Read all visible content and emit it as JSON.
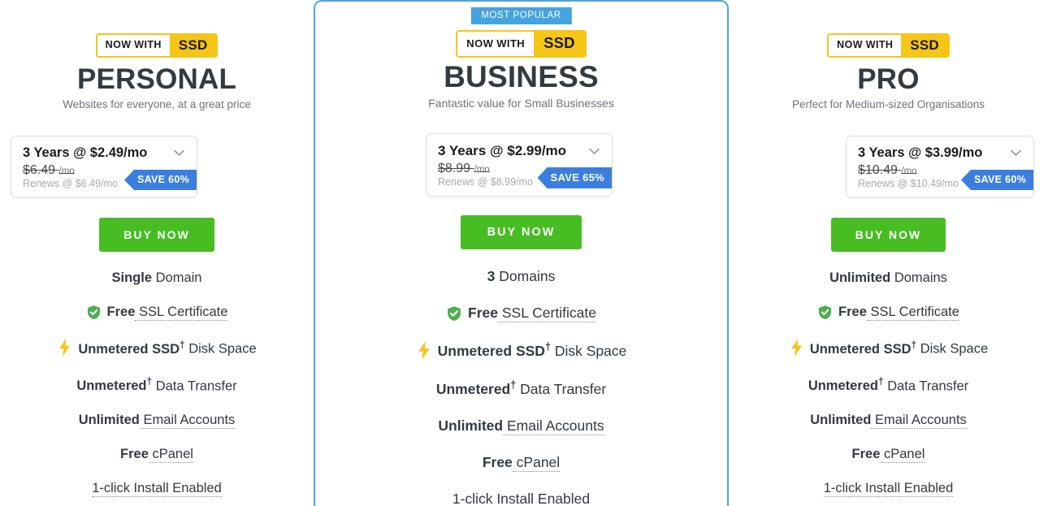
{
  "page": {
    "most_popular_label": "MOST POPULAR",
    "colors": {
      "highlight_border": "#4fa3dd",
      "popular_badge": "#44a3e0",
      "ssd_yellow": "#f5c518",
      "buy_green": "#47bd23",
      "save_blue": "#3a7fe0",
      "shield_green": "#4caf50",
      "bolt_yellow": "#f7c21b",
      "title_gray": "#333a40"
    }
  },
  "plans": [
    {
      "id": "personal",
      "badge": {
        "prefix": "NOW WITH",
        "suffix": "SSD"
      },
      "title": "PERSONAL",
      "subtitle": "Websites for everyone, at a great price",
      "price": {
        "term": "3 Years @ $2.49/mo",
        "old_price": "$6.49",
        "old_unit": "/mo",
        "renews": "Renews @ $6.49/mo",
        "save": "SAVE 60%"
      },
      "buy_label": "BUY NOW",
      "features": [
        {
          "icon": "none",
          "strong": "Single",
          "rest": " Domain",
          "dotted": false,
          "dagger": false
        },
        {
          "icon": "shield-check",
          "strong": "Free",
          "rest": " SSL Certificate",
          "dotted": true,
          "dagger": false
        },
        {
          "icon": "lightning-bolt",
          "strong": "Unmetered SSD",
          "rest": " Disk Space",
          "dotted": false,
          "dagger": true
        },
        {
          "icon": "none",
          "strong": "Unmetered",
          "rest": " Data Transfer",
          "dotted": false,
          "dagger": true
        },
        {
          "icon": "none",
          "strong": "Unlimited",
          "rest": " Email Accounts",
          "dotted": true,
          "dagger": false
        },
        {
          "icon": "none",
          "strong": "Free",
          "rest": " cPanel",
          "dotted": true,
          "dagger": false
        },
        {
          "icon": "none",
          "strong": "",
          "rest": "1-click Install Enabled",
          "dotted": true,
          "dagger": false
        }
      ]
    },
    {
      "id": "business",
      "badge": {
        "prefix": "NOW WITH",
        "suffix": "SSD"
      },
      "title": "BUSINESS",
      "subtitle": "Fantastic value for Small Businesses",
      "price": {
        "term": "3 Years @ $2.99/mo",
        "old_price": "$8.99",
        "old_unit": "/mo",
        "renews": "Renews @ $8.99/mo",
        "save": "SAVE 65%"
      },
      "buy_label": "BUY NOW",
      "features": [
        {
          "icon": "none",
          "strong": "3",
          "rest": " Domains",
          "dotted": false,
          "dagger": false
        },
        {
          "icon": "shield-check",
          "strong": "Free",
          "rest": " SSL Certificate",
          "dotted": true,
          "dagger": false
        },
        {
          "icon": "lightning-bolt",
          "strong": "Unmetered SSD",
          "rest": " Disk Space",
          "dotted": false,
          "dagger": true
        },
        {
          "icon": "none",
          "strong": "Unmetered",
          "rest": " Data Transfer",
          "dotted": false,
          "dagger": true
        },
        {
          "icon": "none",
          "strong": "Unlimited",
          "rest": " Email Accounts",
          "dotted": true,
          "dagger": false
        },
        {
          "icon": "none",
          "strong": "Free",
          "rest": " cPanel",
          "dotted": true,
          "dagger": false
        },
        {
          "icon": "none",
          "strong": "",
          "rest": "1-click Install Enabled",
          "dotted": true,
          "dagger": false
        }
      ]
    },
    {
      "id": "pro",
      "badge": {
        "prefix": "NOW WITH",
        "suffix": "SSD"
      },
      "title": "PRO",
      "subtitle": "Perfect for Medium-sized Organisations",
      "price": {
        "term": "3 Years @ $3.99/mo",
        "old_price": "$10.49",
        "old_unit": "/mo",
        "renews": "Renews @ $10.49/mo",
        "save": "SAVE 60%"
      },
      "buy_label": "BUY NOW",
      "features": [
        {
          "icon": "none",
          "strong": "Unlimited",
          "rest": " Domains",
          "dotted": false,
          "dagger": false
        },
        {
          "icon": "shield-check",
          "strong": "Free",
          "rest": " SSL Certificate",
          "dotted": true,
          "dagger": false
        },
        {
          "icon": "lightning-bolt",
          "strong": "Unmetered SSD",
          "rest": " Disk Space",
          "dotted": false,
          "dagger": true
        },
        {
          "icon": "none",
          "strong": "Unmetered",
          "rest": " Data Transfer",
          "dotted": false,
          "dagger": true
        },
        {
          "icon": "none",
          "strong": "Unlimited",
          "rest": " Email Accounts",
          "dotted": true,
          "dagger": false
        },
        {
          "icon": "none",
          "strong": "Free",
          "rest": " cPanel",
          "dotted": true,
          "dagger": false
        },
        {
          "icon": "none",
          "strong": "",
          "rest": "1-click Install Enabled",
          "dotted": true,
          "dagger": false
        }
      ]
    }
  ]
}
